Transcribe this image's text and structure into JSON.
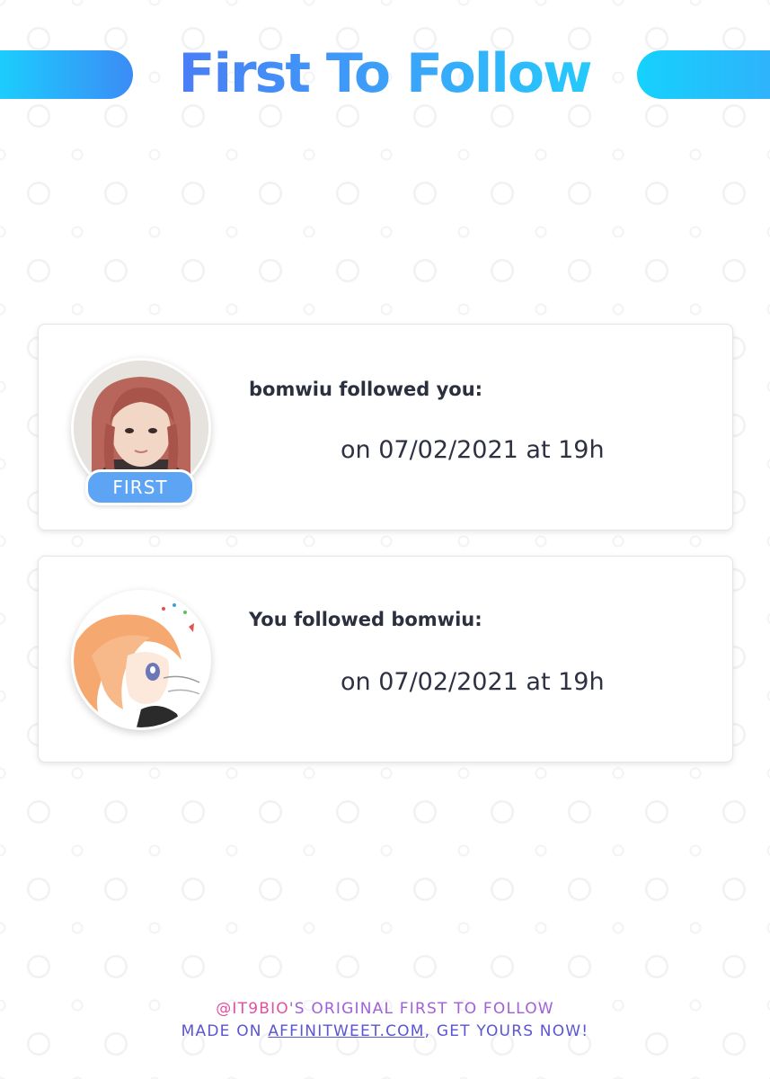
{
  "header": {
    "title": "First To Follow"
  },
  "cards": [
    {
      "event_text": "bomwiu followed you:",
      "date_text": "on 07/02/2021 at 19h",
      "badge": "FIRST",
      "avatar": "profile-photo"
    },
    {
      "event_text": "You followed bomwiu:",
      "date_text": "on 07/02/2021 at 19h",
      "avatar": "anime-character-illustration"
    }
  ],
  "footer": {
    "handle": "@IT9BIO",
    "line1_rest": "'S ORIGINAL FIRST TO FOLLOW",
    "line2_prefix": "MADE ON ",
    "link_text": "AFFINITWEET.COM",
    "line2_suffix": ", GET YOURS NOW!"
  },
  "colors": {
    "accent_blue": "#3b8cf6",
    "accent_cyan": "#1ccdfd",
    "badge_blue": "#5ea4f5",
    "footer_pink": "#e34f9f",
    "footer_purple": "#5a55d0"
  }
}
